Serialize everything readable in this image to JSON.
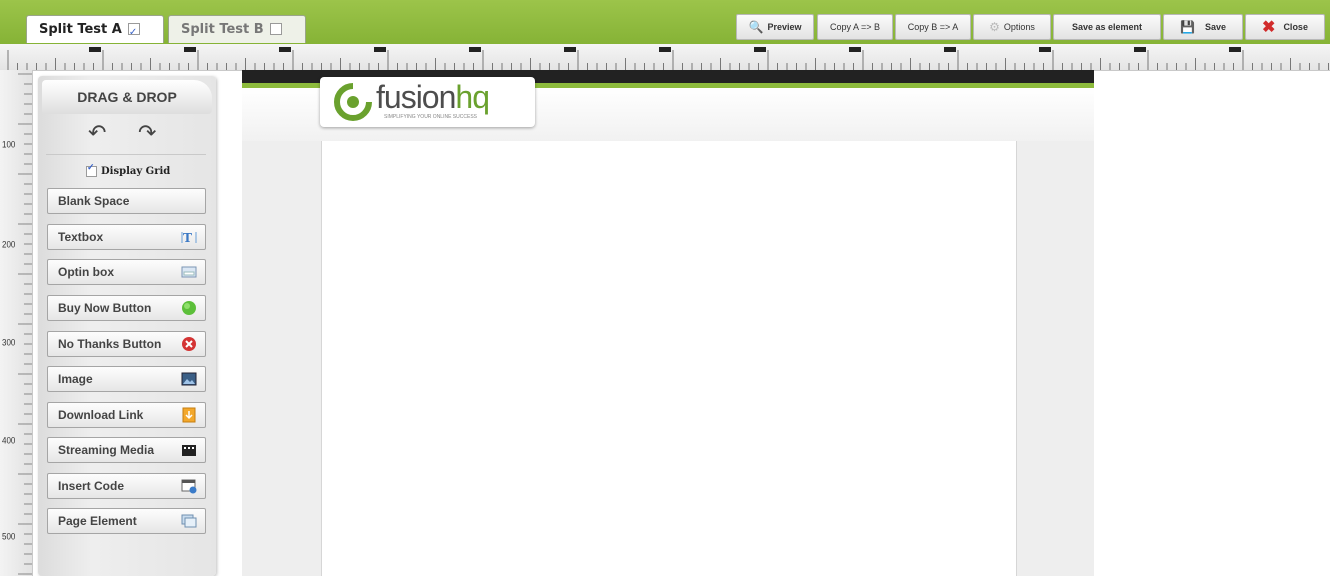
{
  "tabs": {
    "a_label": "Split Test A",
    "b_label": "Split Test B"
  },
  "toolbar": {
    "preview": "Preview",
    "copy_a_b": "Copy A => B",
    "copy_b_a": "Copy B => A",
    "options": "Options",
    "save_as_element": "Save as element",
    "save": "Save",
    "close": "Close"
  },
  "ruler": {
    "vertical_labels": [
      "100",
      "200",
      "300",
      "400",
      "500"
    ]
  },
  "panel": {
    "title": "DRAG & DROP",
    "display_grid": "Display Grid",
    "tools": [
      {
        "label": "Blank Space",
        "icon": "none"
      },
      {
        "label": "Textbox",
        "icon": "textbox-icon"
      },
      {
        "label": "Optin box",
        "icon": "optin-box-icon"
      },
      {
        "label": "Buy Now Button",
        "icon": "green-dot-icon"
      },
      {
        "label": "No Thanks Button",
        "icon": "red-x-icon"
      },
      {
        "label": "Image",
        "icon": "image-icon"
      },
      {
        "label": "Download Link",
        "icon": "download-icon"
      },
      {
        "label": "Streaming Media",
        "icon": "film-icon"
      },
      {
        "label": "Insert Code",
        "icon": "code-icon"
      },
      {
        "label": "Page Element",
        "icon": "page-element-icon"
      }
    ]
  },
  "logo": {
    "brand_main": "fusion",
    "brand_accent": "hq",
    "tagline": "SIMPLIFYING YOUR ONLINE SUCCESS"
  },
  "colors": {
    "accent_green": "#8dbb3c",
    "header_black": "#222222"
  }
}
